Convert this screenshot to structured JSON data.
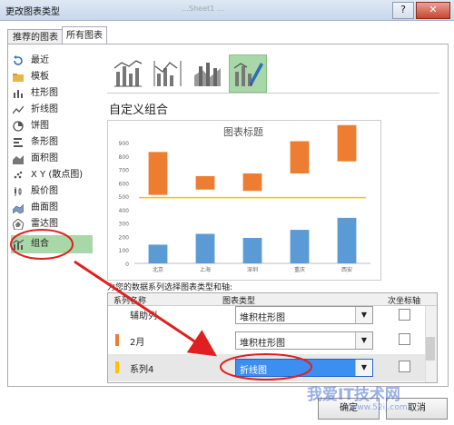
{
  "window": {
    "title": "更改图表类型",
    "faded_title": "…Sheet1 …",
    "help_label": "?",
    "close_label": "✕"
  },
  "tabs": [
    {
      "label": "推荐的图表"
    },
    {
      "label": "所有图表"
    }
  ],
  "sidebar": {
    "items": [
      {
        "label": "最近",
        "icon": "recent-icon"
      },
      {
        "label": "模板",
        "icon": "folder-icon"
      },
      {
        "label": "柱形图",
        "icon": "column-chart-icon"
      },
      {
        "label": "折线图",
        "icon": "line-chart-icon"
      },
      {
        "label": "饼图",
        "icon": "pie-chart-icon"
      },
      {
        "label": "条形图",
        "icon": "bar-chart-icon"
      },
      {
        "label": "面积图",
        "icon": "area-chart-icon"
      },
      {
        "label": "X Y (散点图)",
        "icon": "scatter-chart-icon"
      },
      {
        "label": "股价图",
        "icon": "stock-chart-icon"
      },
      {
        "label": "曲面图",
        "icon": "surface-chart-icon"
      },
      {
        "label": "雷达图",
        "icon": "radar-chart-icon"
      },
      {
        "label": "组合",
        "icon": "combo-chart-icon",
        "selected": true
      }
    ]
  },
  "main": {
    "section_title": "自定义组合",
    "instruction": "为您的数据系列选择图表类型和轴:",
    "table_headers": {
      "series_name": "系列名称",
      "chart_type": "图表类型",
      "secondary_axis": "次坐标轴"
    },
    "series_rows": [
      {
        "name": "辅助列",
        "type": "堆积柱形图",
        "color": "#ffffff"
      },
      {
        "name": "2月",
        "type": "堆积柱形图",
        "color": "#ed7d31"
      },
      {
        "name": "系列4",
        "type": "折线图",
        "color": "#ffc000",
        "selected": true
      }
    ]
  },
  "buttons": {
    "ok": "确定",
    "cancel": "取消"
  },
  "watermark": {
    "text": "我爱IT技术网",
    "url": "www.52ij.com"
  },
  "chart_data": {
    "type": "bar",
    "title": "图表标题",
    "categories": [
      "北京",
      "上海",
      "深圳",
      "重庆",
      "西安"
    ],
    "ylim": [
      0,
      900
    ],
    "yticks": [
      0,
      100,
      200,
      300,
      400,
      500,
      600,
      700,
      800,
      900
    ],
    "series": [
      {
        "values": [
          140,
          220,
          190,
          250,
          340
        ],
        "color": "#5b9bd5"
      },
      {
        "values": [
          370,
          330,
          350,
          420,
          420
        ],
        "color": "#ffffff"
      },
      {
        "values": [
          320,
          100,
          130,
          240,
          270
        ],
        "color": "#ed7d31"
      },
      {
        "values": [
          490,
          490,
          490,
          490,
          490
        ],
        "color": "#ffc000",
        "chart": "line"
      }
    ]
  }
}
